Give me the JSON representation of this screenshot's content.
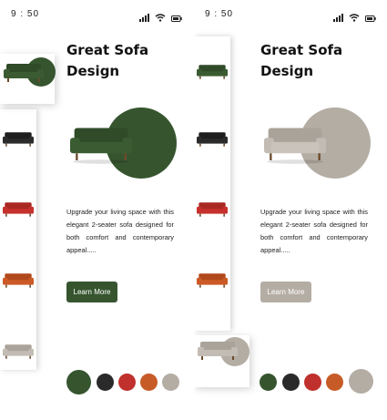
{
  "status": {
    "time": "9 : 50"
  },
  "product": {
    "title_line1": "Great Sofa",
    "title_line2": "Design",
    "description": "Upgrade your living space with this elegant 2-seater sofa designed for both comfort and contemporary appeal.....",
    "button_label": "Learn More"
  },
  "screens": [
    {
      "selected_color": "green",
      "accent": "#36552f",
      "sofa_color": "#3b5c32"
    },
    {
      "selected_color": "grey",
      "accent": "#b4ada4",
      "sofa_color": "#c2bcb4"
    }
  ],
  "swatches": [
    {
      "name": "green",
      "color": "#36552f"
    },
    {
      "name": "black",
      "color": "#2a2a2a"
    },
    {
      "name": "red",
      "color": "#c0302c"
    },
    {
      "name": "orange",
      "color": "#c75b27"
    },
    {
      "name": "grey",
      "color": "#b4ada4"
    }
  ],
  "rail_sofas": [
    {
      "name": "green",
      "color": "#3b5c32"
    },
    {
      "name": "black",
      "color": "#2b2b2b"
    },
    {
      "name": "red",
      "color": "#c6312d"
    },
    {
      "name": "orange",
      "color": "#cc5a26"
    },
    {
      "name": "grey",
      "color": "#c2bcb4"
    }
  ]
}
